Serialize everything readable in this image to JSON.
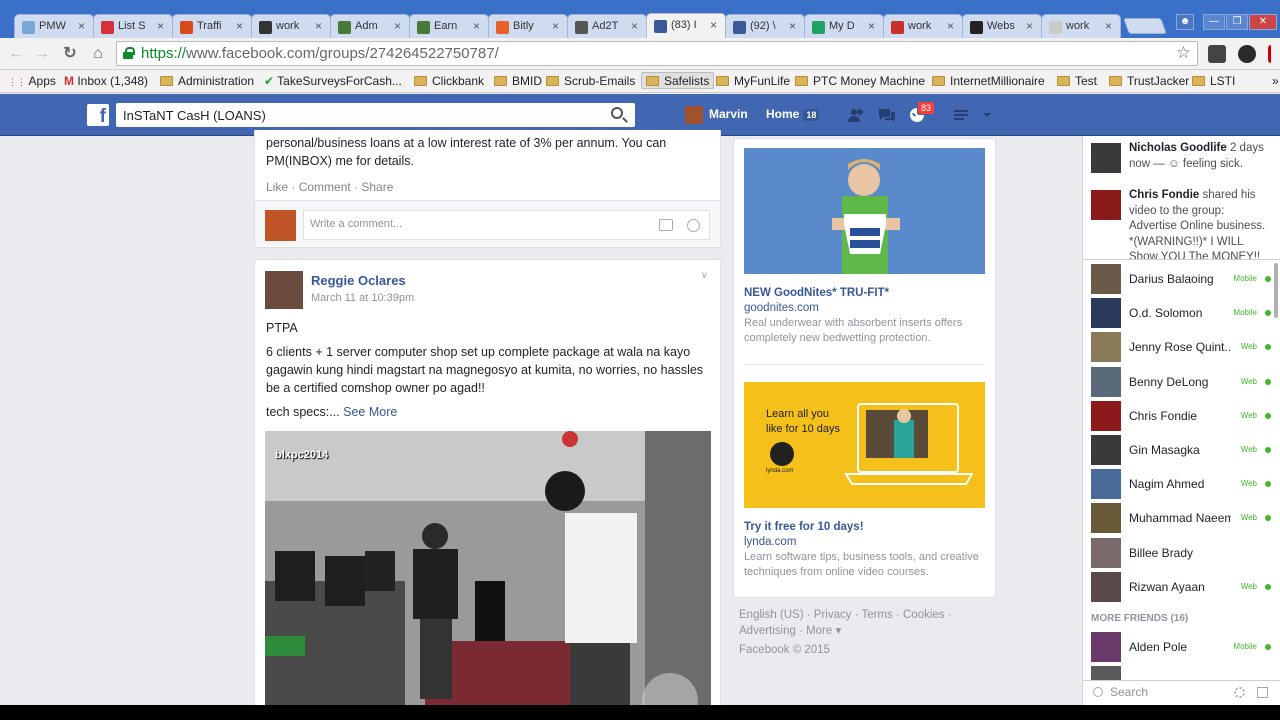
{
  "browser": {
    "tabs": [
      {
        "label": "PMW",
        "color": "#7ba7d8"
      },
      {
        "label": "List S",
        "color": "#d3323a"
      },
      {
        "label": "Traffi",
        "color": "#d84a1b"
      },
      {
        "label": "work",
        "color": "#333333"
      },
      {
        "label": "Adm",
        "color": "#4a7a3a"
      },
      {
        "label": "Earn",
        "color": "#4a7a3a"
      },
      {
        "label": "Bitly",
        "color": "#e8612c"
      },
      {
        "label": "Ad2T",
        "color": "#555555"
      },
      {
        "label": "(83) I",
        "color": "#3b5998"
      },
      {
        "label": "(92) \\",
        "color": "#3b5998"
      },
      {
        "label": "My D",
        "color": "#1fa463"
      },
      {
        "label": "work",
        "color": "#c9302c"
      },
      {
        "label": "Webs",
        "color": "#222222"
      },
      {
        "label": "work",
        "color": "#cccccc"
      }
    ],
    "url_scheme": "https://",
    "url_rest": "www.facebook.com/groups/274264522750787/",
    "bookmarks": [
      {
        "label": "Apps",
        "type": "apps"
      },
      {
        "label": "Inbox (1,348)",
        "type": "gmail"
      },
      {
        "label": "Administration",
        "type": "folder"
      },
      {
        "label": "TakeSurveysForCash...",
        "type": "check"
      },
      {
        "label": "Clickbank",
        "type": "folder"
      },
      {
        "label": "BMID",
        "type": "folder"
      },
      {
        "label": "Scrub-Emails",
        "type": "folder"
      },
      {
        "label": "Safelists",
        "type": "folder"
      },
      {
        "label": "MyFunLife",
        "type": "folder"
      },
      {
        "label": "PTC Money Machine",
        "type": "folder"
      },
      {
        "label": "InternetMillionaire",
        "type": "folder"
      },
      {
        "label": "Test",
        "type": "folder"
      },
      {
        "label": "TrustJacker",
        "type": "folder"
      },
      {
        "label": "LSTI",
        "type": "folder"
      }
    ],
    "bookmarks_more": "»"
  },
  "fb": {
    "search_value": "InSTaNT CasH (LOANS)",
    "user_name": "Marvin",
    "home_label": "Home",
    "home_count": "18",
    "notif_count": "83"
  },
  "post1": {
    "text": "personal/business loans at a low interest rate of 3% per annum. You can PM(INBOX) me for details.",
    "like": "Like",
    "comment": "Comment",
    "share": "Share",
    "comment_placeholder": "Write a comment..."
  },
  "post2": {
    "author": "Reggie Oclares",
    "time": "March 11 at 10:39pm",
    "line1": "PTPA",
    "line2": "6 clients + 1 server computer shop set up complete package at wala na kayo gagawin kung hindi magstart na magnegosyo at kumita, no worries, no hassles be a certified comshop owner po agad!!",
    "line3": "tech specs:...",
    "see_more": "See More",
    "watermark": "blxpc2014"
  },
  "ads": [
    {
      "title": "NEW GoodNites* TRU-FIT*",
      "domain": "goodnites.com",
      "desc": "Real underwear with absorbent inserts offers completely new bedwetting protection."
    },
    {
      "title": "Try it free for 10 days!",
      "domain": "lynda.com",
      "desc": "Learn software tips, business tools, and creative techniques from online video courses.",
      "banner_text": "Learn all you like for 10 days",
      "logo_text": "lynda.com"
    }
  ],
  "footer": {
    "line1": "English (US) · Privacy · Terms · Cookies ·",
    "line2": "Advertising · More ▾",
    "line3": "Facebook © 2015"
  },
  "chat": {
    "ticker": [
      {
        "name": "Nicholas Goodlife",
        "rest": " 2 days now — ☺ feeling sick."
      },
      {
        "name": "Chris Fondie",
        "rest": " shared his video to the group: Advertise Online business. *(WARNING!!)* I WILL Show YOU The MONEY!!"
      }
    ],
    "friends": [
      {
        "name": "Darius Balaoing",
        "status": "Mobile"
      },
      {
        "name": "O.d. Solomon",
        "status": "Mobile"
      },
      {
        "name": "Jenny Rose Quint...",
        "status": "Web"
      },
      {
        "name": "Benny DeLong",
        "status": "Web"
      },
      {
        "name": "Chris Fondie",
        "status": "Web"
      },
      {
        "name": "Gin Masagka",
        "status": "Web"
      },
      {
        "name": "Nagim Ahmed",
        "status": "Web"
      },
      {
        "name": "Muhammad Naeem",
        "status": "Web"
      },
      {
        "name": "Billee Brady",
        "status": ""
      },
      {
        "name": "Rizwan Ayaan",
        "status": "Web"
      }
    ],
    "more_friends": "MORE FRIENDS (16)",
    "more_list": [
      {
        "name": "Alden Pole",
        "status": "Mobile"
      }
    ],
    "search_placeholder": "Search"
  },
  "colors": {
    "fb_blue": "#4267b2",
    "link": "#365899",
    "online": "#42b72a",
    "tab_bg": "#3b70c8"
  }
}
